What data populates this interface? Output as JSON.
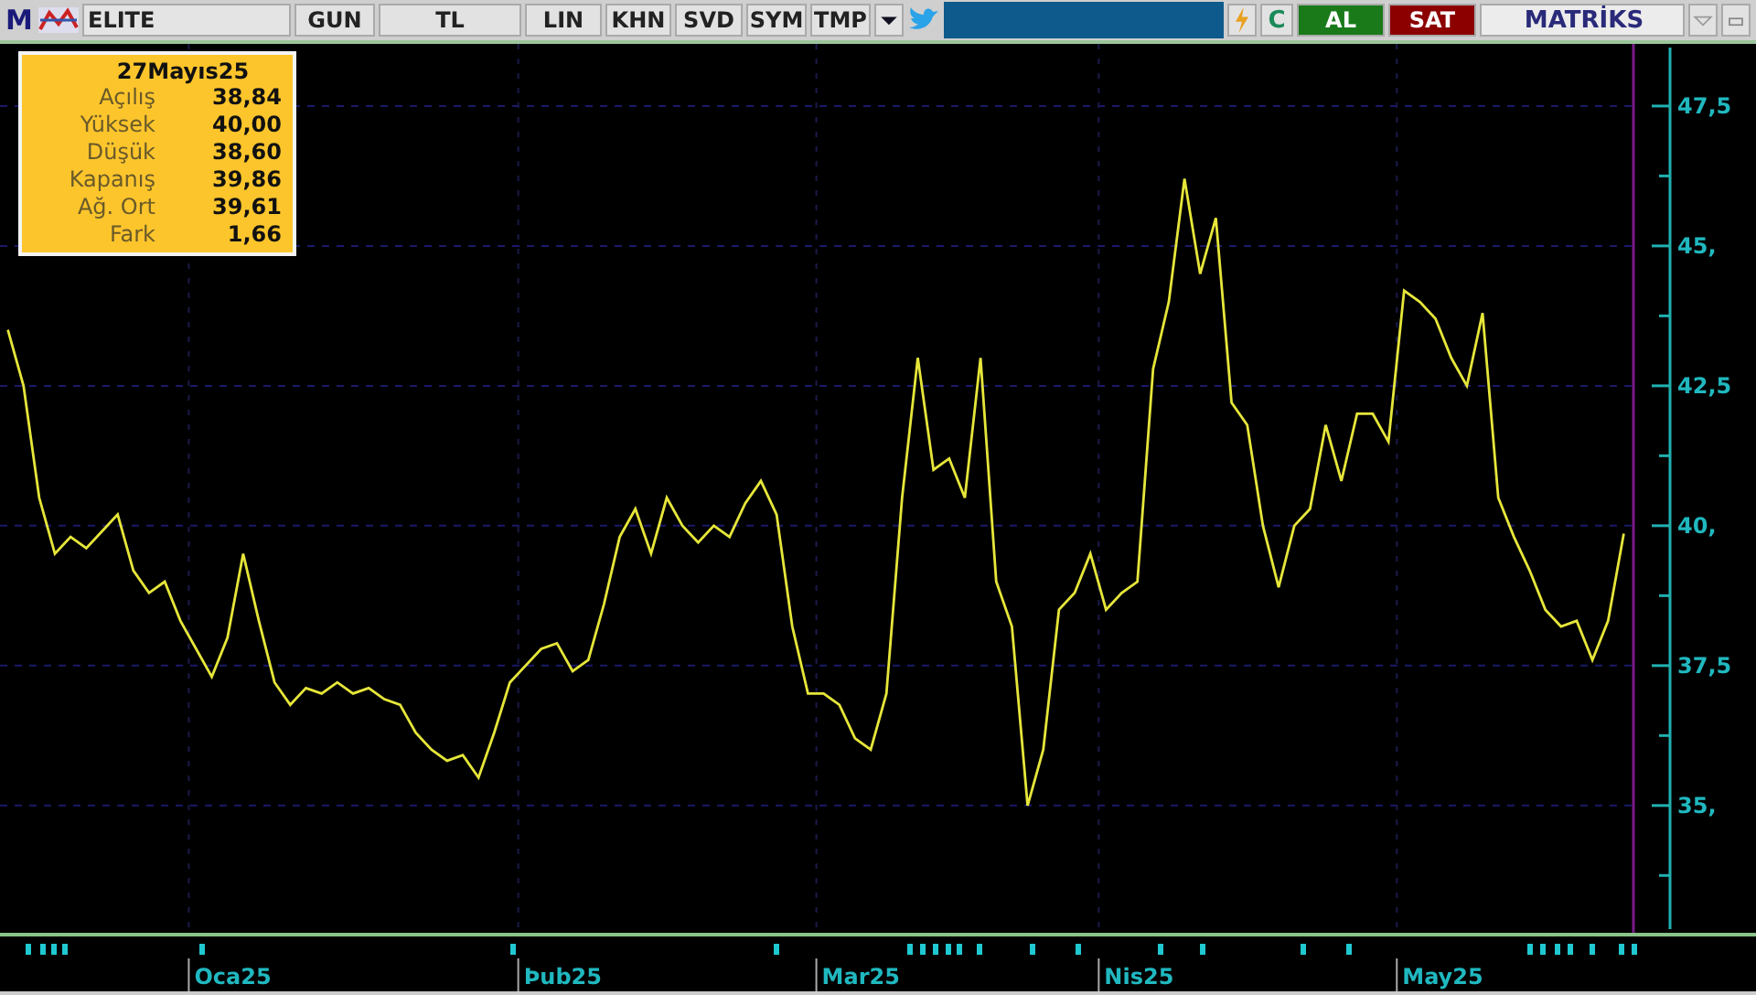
{
  "toolbar": {
    "logo": "M",
    "symbol": "ELITE",
    "buttons": [
      "GUN",
      "TL",
      "LIN",
      "KHN",
      "SVD",
      "SYM",
      "TMP"
    ],
    "refresh": "C",
    "buy": "AL",
    "sell": "SAT",
    "brand": "MATRİKS"
  },
  "info_box": {
    "title": "27Mayıs25",
    "rows": [
      {
        "label": "Açılış",
        "value": "38,84"
      },
      {
        "label": "Yüksek",
        "value": "40,00"
      },
      {
        "label": "Düşük",
        "value": "38,60"
      },
      {
        "label": "Kapanış",
        "value": "39,86"
      },
      {
        "label": "Ağ. Ort",
        "value": "39,61"
      },
      {
        "label": "Fark",
        "value": "1,66"
      }
    ]
  },
  "chart": {
    "chart_data": {
      "type": "line",
      "ylim": [
        32.66,
        48.61
      ],
      "grid": true,
      "series": [
        {
          "color": "#e6e63a",
          "values": [
            43.5,
            42.5,
            40.5,
            39.5,
            39.8,
            39.6,
            39.9,
            40.2,
            39.2,
            38.8,
            39.0,
            38.3,
            37.8,
            37.3,
            38.0,
            39.5,
            38.3,
            37.2,
            36.8,
            37.1,
            37.0,
            37.2,
            37.0,
            37.1,
            36.9,
            36.8,
            36.3,
            36.0,
            35.8,
            35.9,
            35.5,
            36.3,
            37.2,
            37.5,
            37.8,
            37.9,
            37.4,
            37.6,
            38.6,
            39.8,
            40.3,
            39.5,
            40.5,
            40.0,
            39.7,
            40.0,
            39.8,
            40.4,
            40.8,
            40.2,
            38.2,
            37.0,
            37.0,
            36.8,
            36.2,
            36.0,
            37.0,
            40.5,
            43.0,
            41.0,
            41.2,
            40.5,
            43.0,
            39.0,
            38.2,
            35.0,
            36.0,
            38.5,
            38.8,
            39.5,
            38.5,
            38.8,
            39.0,
            42.8,
            44.0,
            46.2,
            44.5,
            45.5,
            42.2,
            41.8,
            40.0,
            38.9,
            40.0,
            40.3,
            41.8,
            40.8,
            42.0,
            42.0,
            41.5,
            44.2,
            44.0,
            43.7,
            43.0,
            42.5,
            43.8,
            40.5,
            39.8,
            39.2,
            38.5,
            38.2,
            38.3,
            37.6,
            38.3,
            39.86
          ]
        }
      ],
      "yticks": [
        {
          "value": 47.5,
          "label": "47,5"
        },
        {
          "value": 45,
          "label": "45,"
        },
        {
          "value": 42.5,
          "label": "42,5"
        },
        {
          "value": 40,
          "label": "40,"
        },
        {
          "value": 37.5,
          "label": "37,5"
        },
        {
          "value": 35,
          "label": "35,"
        }
      ]
    },
    "date_labels": [
      "Oca25",
      "Þub25",
      "Mar25",
      "Nis25",
      "May25"
    ]
  }
}
